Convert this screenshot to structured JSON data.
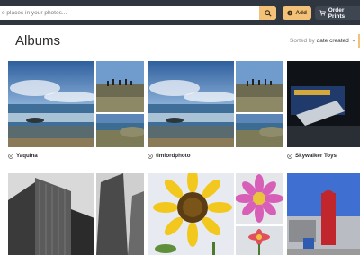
{
  "search": {
    "placeholder": "e places in your photos..."
  },
  "toolbar": {
    "add_label": "Add",
    "order_label": "Order Prints"
  },
  "page": {
    "title": "Albums"
  },
  "sort": {
    "prefix": "Sorted by",
    "value": "date created"
  },
  "albums": [
    {
      "name": "Yaquina"
    },
    {
      "name": "timfordphoto"
    },
    {
      "name": "Skywalker Toys"
    }
  ],
  "colors": {
    "accent": "#f3c278",
    "topbar": "#2f3640",
    "order_button": "#3e4651"
  }
}
